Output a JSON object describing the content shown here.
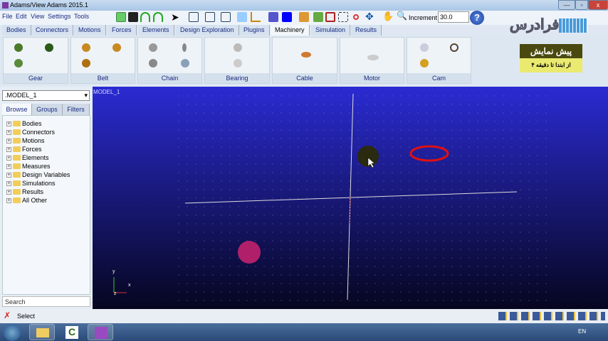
{
  "window": {
    "title": "Adams/View Adams 2015.1",
    "min": "—",
    "max": "▫",
    "close": "x"
  },
  "menu": [
    "File",
    "Edit",
    "View",
    "Settings",
    "Tools"
  ],
  "toolbar": {
    "increment_label": "Increment",
    "increment_value": "30.0",
    "help": "?"
  },
  "tabs": [
    "Bodies",
    "Connectors",
    "Motions",
    "Forces",
    "Elements",
    "Design Exploration",
    "Plugins",
    "Machinery",
    "Simulation",
    "Results"
  ],
  "active_tab": "Machinery",
  "ribbon_groups": [
    "Gear",
    "Belt",
    "Chain",
    "Bearing",
    "Cable",
    "Motor",
    "Cam"
  ],
  "promo": {
    "logo": "فرادرس",
    "title": "پیش نمایش",
    "subtitle": "از ابتدا تا دقیقه ۴"
  },
  "browser": {
    "model": ".MODEL_1",
    "tabs": [
      "Browse",
      "Groups",
      "Filters"
    ],
    "tree": [
      "Bodies",
      "Connectors",
      "Motions",
      "Forces",
      "Elements",
      "Measures",
      "Design Variables",
      "Simulations",
      "Results",
      "All Other"
    ],
    "search_placeholder": "Search"
  },
  "viewport": {
    "title": "MODEL_1",
    "axes": {
      "x": "x",
      "y": "y",
      "z": "z"
    }
  },
  "status": {
    "text": "Select"
  },
  "taskbar": {
    "lang": "EN"
  }
}
